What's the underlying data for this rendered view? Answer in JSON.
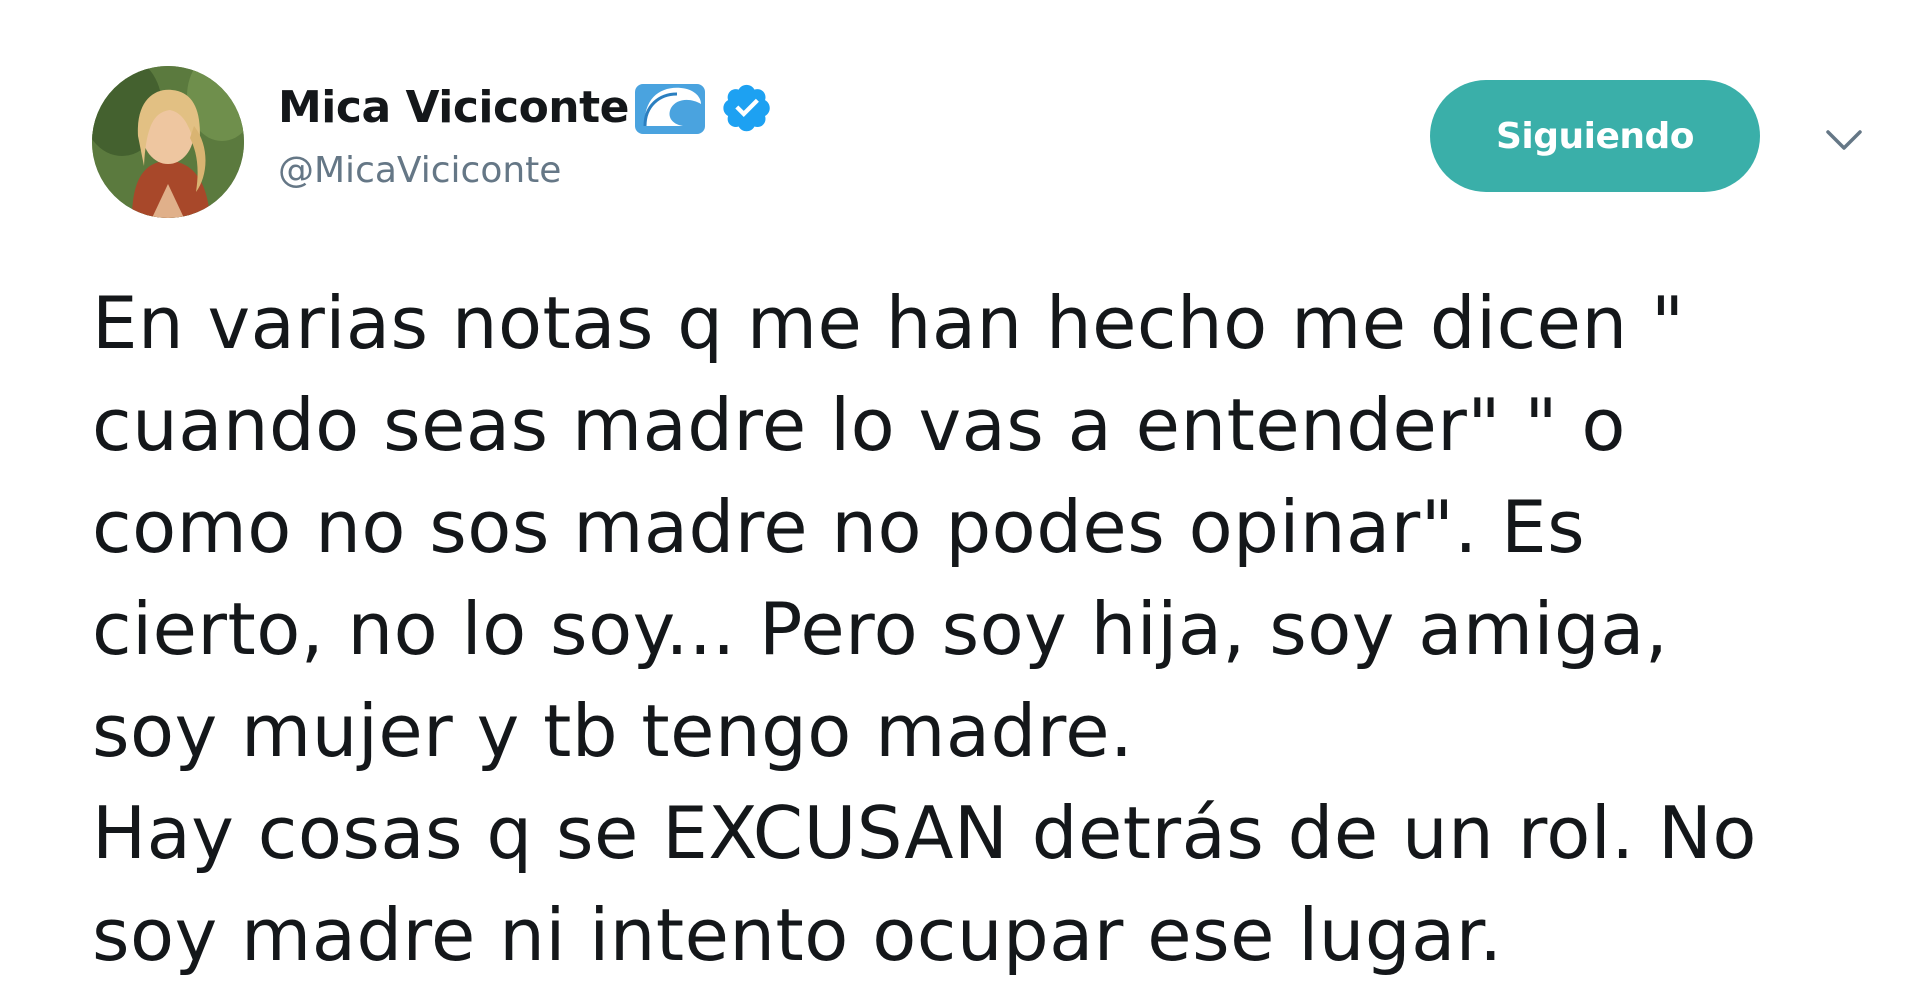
{
  "user": {
    "display_name": "Mica Viciconte",
    "name_emoji": "wave-emoji-icon",
    "verified_badge": "verified-icon",
    "handle": "@MicaViciconte"
  },
  "actions": {
    "follow_label": "Siguiendo",
    "menu_icon": "chevron-down-icon"
  },
  "tweet": {
    "text": "En varias notas q me han hecho me dicen \"\ncuando seas madre lo vas a entender\" \" o\ncomo no sos madre no podes opinar\". Es\ncierto, no lo soy... Pero soy hija, soy amiga,\nsoy mujer y tb tengo madre.\nHay cosas q se EXCUSAN detrás de un rol. No\nsoy madre ni intento ocupar ese lugar."
  },
  "colors": {
    "follow_button": "#3aafa9",
    "verified": "#1da1f2",
    "handle": "#657786",
    "text": "#14171a"
  }
}
